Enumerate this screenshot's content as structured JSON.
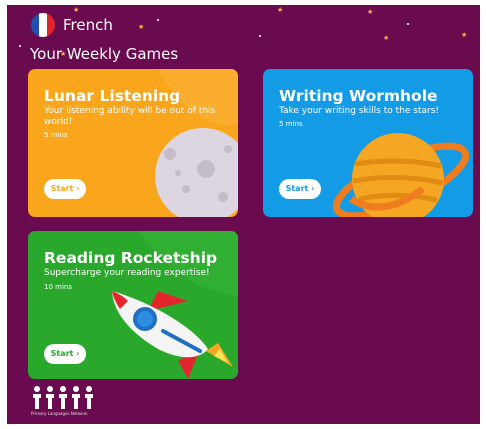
{
  "header": {
    "language": "French",
    "flag_icon": "france-flag-icon",
    "flag_colors": [
      "#1f4fb0",
      "#ffffff",
      "#e0232f"
    ]
  },
  "section_title": "Your Weekly Games",
  "colors": {
    "background": "#6a0b4f",
    "star": "#f5b83a"
  },
  "cards": [
    {
      "title": "Lunar Listening",
      "description": "Your listening ability will be out of this world!",
      "duration": "5 mins",
      "button": "Start ›",
      "color": "#f9a61c",
      "illustration": "moon-icon"
    },
    {
      "title": "Writing Wormhole",
      "description": "Take your writing skills to the stars!",
      "duration": "5 mins",
      "button": "Start ›",
      "color": "#139be6",
      "illustration": "ringed-planet-icon"
    },
    {
      "title": "Reading Rocketship",
      "description": "Supercharge your reading expertise!",
      "duration": "10 mins",
      "button": "Start ›",
      "color": "#2aa82c",
      "illustration": "rocket-icon"
    }
  ],
  "footer": {
    "logo_icon": "people-logo-icon",
    "logo_text": "Primary Languages Network"
  }
}
